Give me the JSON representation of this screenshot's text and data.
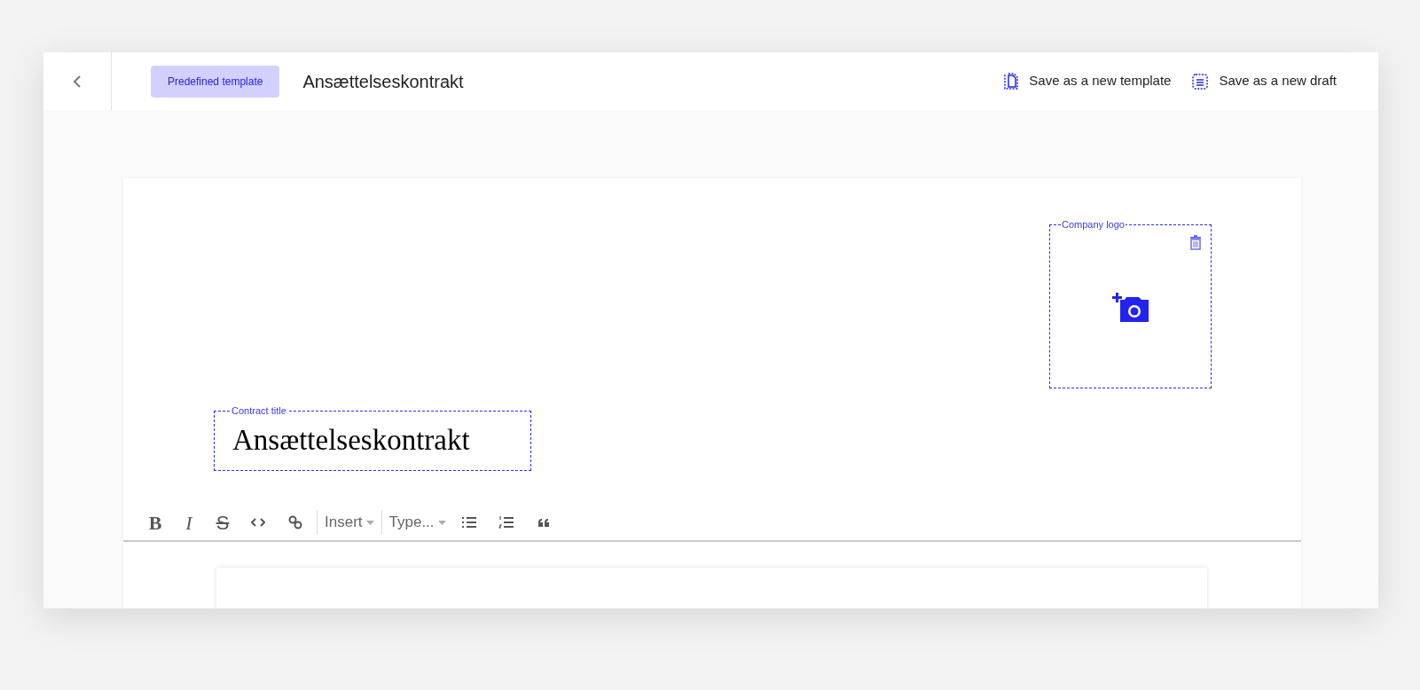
{
  "header": {
    "badge": "Predefined template",
    "title": "Ansættelseskontrakt",
    "actions": [
      {
        "kind": "template",
        "label": "Save as a new template"
      },
      {
        "kind": "draft",
        "label": "Save as a new draft"
      }
    ]
  },
  "logo_box": {
    "label": "Company logo"
  },
  "contract_title": {
    "label": "Contract title",
    "value": "Ansættelseskontrakt"
  },
  "toolbar": [
    {
      "kind": "bold",
      "label": "B"
    },
    {
      "kind": "italic",
      "label": "I"
    },
    {
      "kind": "strike",
      "label": "S"
    },
    {
      "kind": "code"
    },
    {
      "kind": "link"
    },
    {
      "kind": "divider"
    },
    {
      "kind": "dropdown",
      "label": "Insert"
    },
    {
      "kind": "divider"
    },
    {
      "kind": "dropdown",
      "label": "Type..."
    },
    {
      "kind": "bullets"
    },
    {
      "kind": "numbers"
    },
    {
      "kind": "quote"
    }
  ]
}
